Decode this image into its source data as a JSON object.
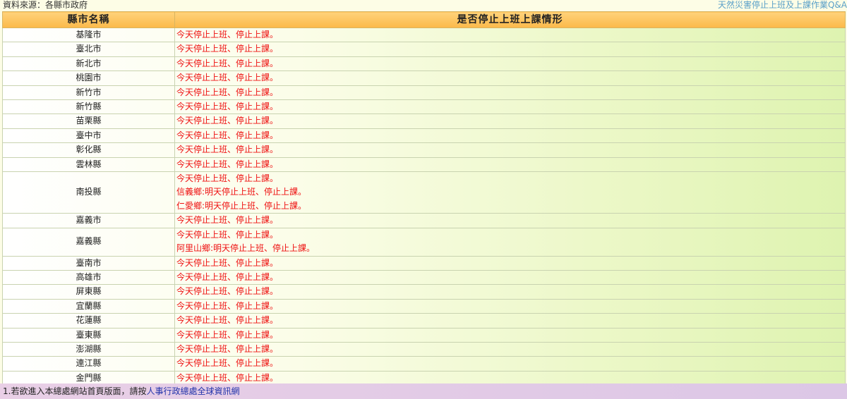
{
  "header": {
    "source": "資料來源：各縣市政府",
    "qa_link": "天然災害停止上班及上課作業Q&A"
  },
  "table": {
    "columns": [
      "縣市名稱",
      "是否停止上班上課情形"
    ],
    "rows": [
      {
        "city": "基隆市",
        "lines": [
          "今天停止上班、停止上課。"
        ]
      },
      {
        "city": "臺北市",
        "lines": [
          "今天停止上班、停止上課。"
        ]
      },
      {
        "city": "新北市",
        "lines": [
          "今天停止上班、停止上課。"
        ]
      },
      {
        "city": "桃園市",
        "lines": [
          "今天停止上班、停止上課。"
        ]
      },
      {
        "city": "新竹市",
        "lines": [
          "今天停止上班、停止上課。"
        ]
      },
      {
        "city": "新竹縣",
        "lines": [
          "今天停止上班、停止上課。"
        ]
      },
      {
        "city": "苗栗縣",
        "lines": [
          "今天停止上班、停止上課。"
        ]
      },
      {
        "city": "臺中市",
        "lines": [
          "今天停止上班、停止上課。"
        ]
      },
      {
        "city": "彰化縣",
        "lines": [
          "今天停止上班、停止上課。"
        ]
      },
      {
        "city": "雲林縣",
        "lines": [
          "今天停止上班、停止上課。"
        ]
      },
      {
        "city": "南投縣",
        "lines": [
          "今天停止上班、停止上課。",
          "信義鄉:明天停止上班、停止上課。",
          "仁愛鄉:明天停止上班、停止上課。"
        ]
      },
      {
        "city": "嘉義市",
        "lines": [
          "今天停止上班、停止上課。"
        ]
      },
      {
        "city": "嘉義縣",
        "lines": [
          "今天停止上班、停止上課。",
          "阿里山鄉:明天停止上班、停止上課。"
        ]
      },
      {
        "city": "臺南市",
        "lines": [
          "今天停止上班、停止上課。"
        ]
      },
      {
        "city": "高雄市",
        "lines": [
          "今天停止上班、停止上課。"
        ]
      },
      {
        "city": "屏東縣",
        "lines": [
          "今天停止上班、停止上課。"
        ]
      },
      {
        "city": "宜蘭縣",
        "lines": [
          "今天停止上班、停止上課。"
        ]
      },
      {
        "city": "花蓮縣",
        "lines": [
          "今天停止上班、停止上課。"
        ]
      },
      {
        "city": "臺東縣",
        "lines": [
          "今天停止上班、停止上課。"
        ]
      },
      {
        "city": "澎湖縣",
        "lines": [
          "今天停止上班、停止上課。"
        ]
      },
      {
        "city": "連江縣",
        "lines": [
          "今天停止上班、停止上課。"
        ]
      },
      {
        "city": "金門縣",
        "lines": [
          "今天停止上班、停止上課。"
        ]
      }
    ]
  },
  "footer": {
    "note_prefix": "1.若欲進入本總處網站首頁版面，請按",
    "link_text": "人事行政總處全球資訊網"
  },
  "colors": {
    "status_text": "#ee1111",
    "header_bg": "#fbb94a",
    "footer_bg": "#e9cfe6",
    "link": "#2233aa"
  }
}
